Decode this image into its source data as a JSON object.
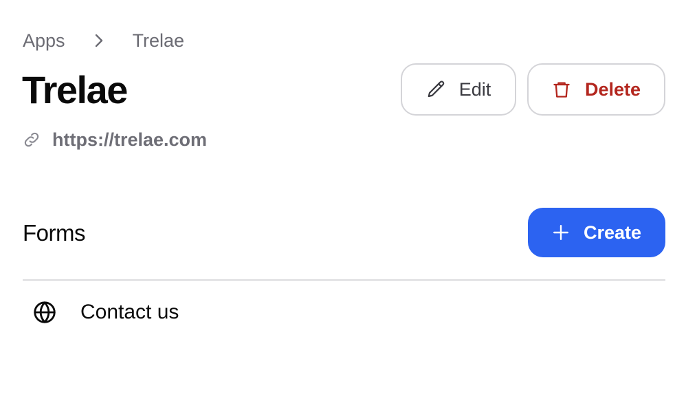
{
  "breadcrumb": {
    "items": [
      "Apps",
      "Trelae"
    ],
    "separator_icon": "chevron-right-icon"
  },
  "app": {
    "title": "Trelae",
    "url": "https://trelae.com",
    "url_icon": "link-icon"
  },
  "actions": {
    "edit_label": "Edit",
    "edit_icon": "pencil-icon",
    "delete_label": "Delete",
    "delete_icon": "trash-icon",
    "delete_color": "#b3261e"
  },
  "forms": {
    "section_title": "Forms",
    "create_label": "Create",
    "create_icon": "plus-icon",
    "create_color": "#2c63f1",
    "items": [
      {
        "label": "Contact us",
        "icon": "globe-icon"
      }
    ]
  }
}
